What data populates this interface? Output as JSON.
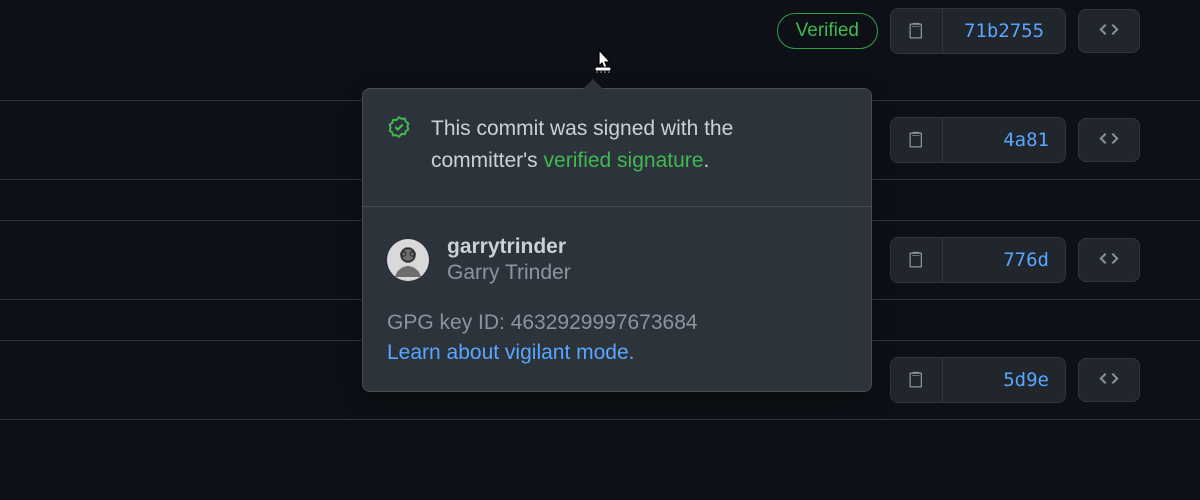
{
  "verified_badge_label": "Verified",
  "commits": [
    {
      "sha": "71b2755"
    },
    {
      "sha": "4a81"
    },
    {
      "sha": "776d"
    },
    {
      "sha": "5d9e"
    }
  ],
  "popover": {
    "header_text_prefix": "This commit was signed with the committer's ",
    "header_text_verified": "verified signature",
    "header_text_suffix": ".",
    "signer_username": "garrytrinder",
    "signer_fullname": "Garry Trinder",
    "gpg_label": "GPG key ID: ",
    "gpg_id": "4632929997673684",
    "vigilant_link": "Learn about vigilant mode."
  }
}
